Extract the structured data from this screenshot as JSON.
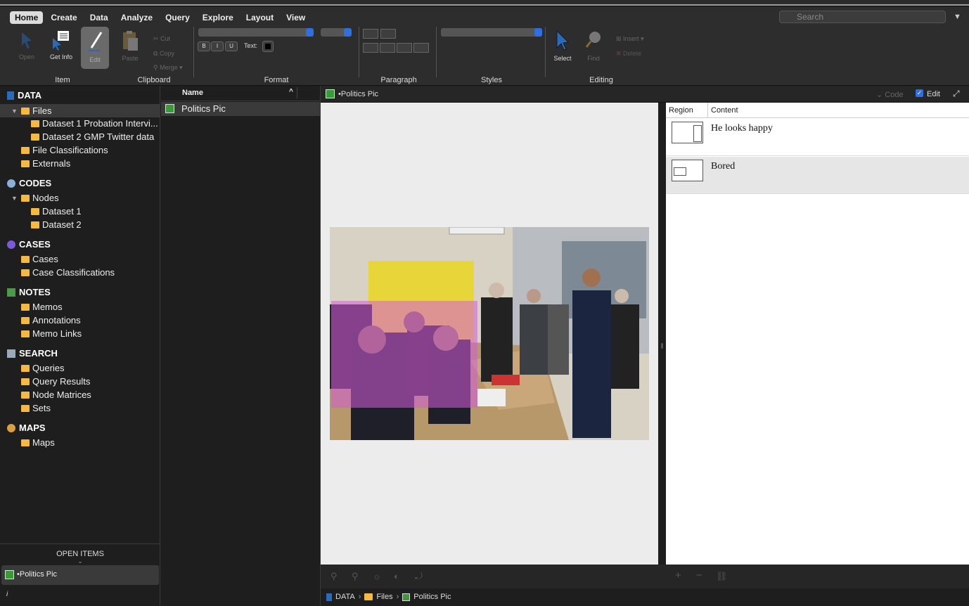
{
  "ribbon": {
    "menu": [
      "Home",
      "Create",
      "Data",
      "Analyze",
      "Query",
      "Explore",
      "Layout",
      "View"
    ],
    "search_placeholder": "Search",
    "groups": {
      "item": "Item",
      "clipboard": "Clipboard",
      "format": "Format",
      "paragraph": "Paragraph",
      "styles": "Styles",
      "editing": "Editing"
    },
    "tools": {
      "open": "Open",
      "get_info": "Get Info",
      "edit": "Edit",
      "paste": "Paste",
      "cut": "Cut",
      "copy": "Copy",
      "merge": "Merge",
      "bold": "B",
      "italic": "I",
      "underline": "U",
      "text_color_label": "Text:",
      "select": "Select",
      "find": "Find",
      "insert": "Insert",
      "delete": "Delete"
    }
  },
  "sidebar": {
    "sections": {
      "data": "DATA",
      "codes": "CODES",
      "cases": "CASES",
      "notes": "NOTES",
      "search": "SEARCH",
      "maps": "MAPS"
    },
    "items": {
      "files": "Files",
      "dataset1": "Dataset 1 Probation Intervi...",
      "dataset2": "Dataset 2 GMP Twitter data",
      "file_classifications": "File Classifications",
      "externals": "Externals",
      "nodes": "Nodes",
      "node_dataset1": "Dataset 1",
      "node_dataset2": "Dataset 2",
      "cases": "Cases",
      "case_classifications": "Case Classifications",
      "memos": "Memos",
      "annotations": "Annotations",
      "memo_links": "Memo Links",
      "queries": "Queries",
      "query_results": "Query Results",
      "node_matrices": "Node Matrices",
      "sets": "Sets",
      "maps": "Maps"
    },
    "open_items_title": "OPEN ITEMS",
    "open_item": "•Politics Pic",
    "info": "i"
  },
  "list": {
    "header": "Name",
    "rows": [
      "Politics Pic"
    ]
  },
  "viewer": {
    "title": "•Politics Pic",
    "code_label": "Code",
    "edit_label": "Edit",
    "table": {
      "headers": [
        "Region",
        "Content"
      ],
      "rows": [
        {
          "content": "He looks happy"
        },
        {
          "content": "Bored"
        }
      ]
    },
    "breadcrumb": [
      "DATA",
      "Files",
      "Politics Pic"
    ]
  }
}
